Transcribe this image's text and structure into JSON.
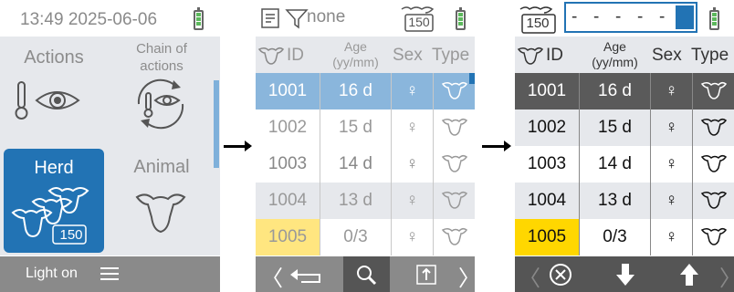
{
  "screen1": {
    "status": {
      "time": "13:49 2025-06-06"
    },
    "tiles": {
      "actions": "Actions",
      "chain_line1": "Chain of",
      "chain_line2": "actions",
      "herd": "Herd",
      "herd_count": "150",
      "animal": "Animal"
    },
    "footer": {
      "light": "Light on",
      "menu_icon": "menu-icon"
    }
  },
  "screen2": {
    "filter_label": "none",
    "herd_count": "150",
    "columns": {
      "id": "ID",
      "age_line1": "Age",
      "age_line2": "(yy/mm)",
      "sex": "Sex",
      "type": "Type"
    },
    "rows": [
      {
        "id": "1001",
        "age": "16 d",
        "sex": "♀"
      },
      {
        "id": "1002",
        "age": "15 d",
        "sex": "♀"
      },
      {
        "id": "1003",
        "age": "14 d",
        "sex": "♀"
      },
      {
        "id": "1004",
        "age": "13 d",
        "sex": "♀"
      },
      {
        "id": "1005",
        "age": "0/3",
        "sex": "♀"
      }
    ]
  },
  "screen3": {
    "herd_count": "150",
    "entry_segments": [
      "-",
      "-",
      "-",
      "-",
      "-"
    ],
    "columns": {
      "id": "ID",
      "age_line1": "Age",
      "age_line2": "(yy/mm)",
      "sex": "Sex",
      "type": "Type"
    },
    "rows": [
      {
        "id": "1001",
        "age": "16 d",
        "sex": "♀"
      },
      {
        "id": "1002",
        "age": "15 d",
        "sex": "♀"
      },
      {
        "id": "1003",
        "age": "14 d",
        "sex": "♀"
      },
      {
        "id": "1004",
        "age": "13 d",
        "sex": "♀"
      },
      {
        "id": "1005",
        "age": "0/3",
        "sex": "♀"
      }
    ]
  },
  "colors": {
    "accent_blue": "#2273b4",
    "highlight_yellow": "#ffd700",
    "battery_green": "#5cb85c"
  }
}
